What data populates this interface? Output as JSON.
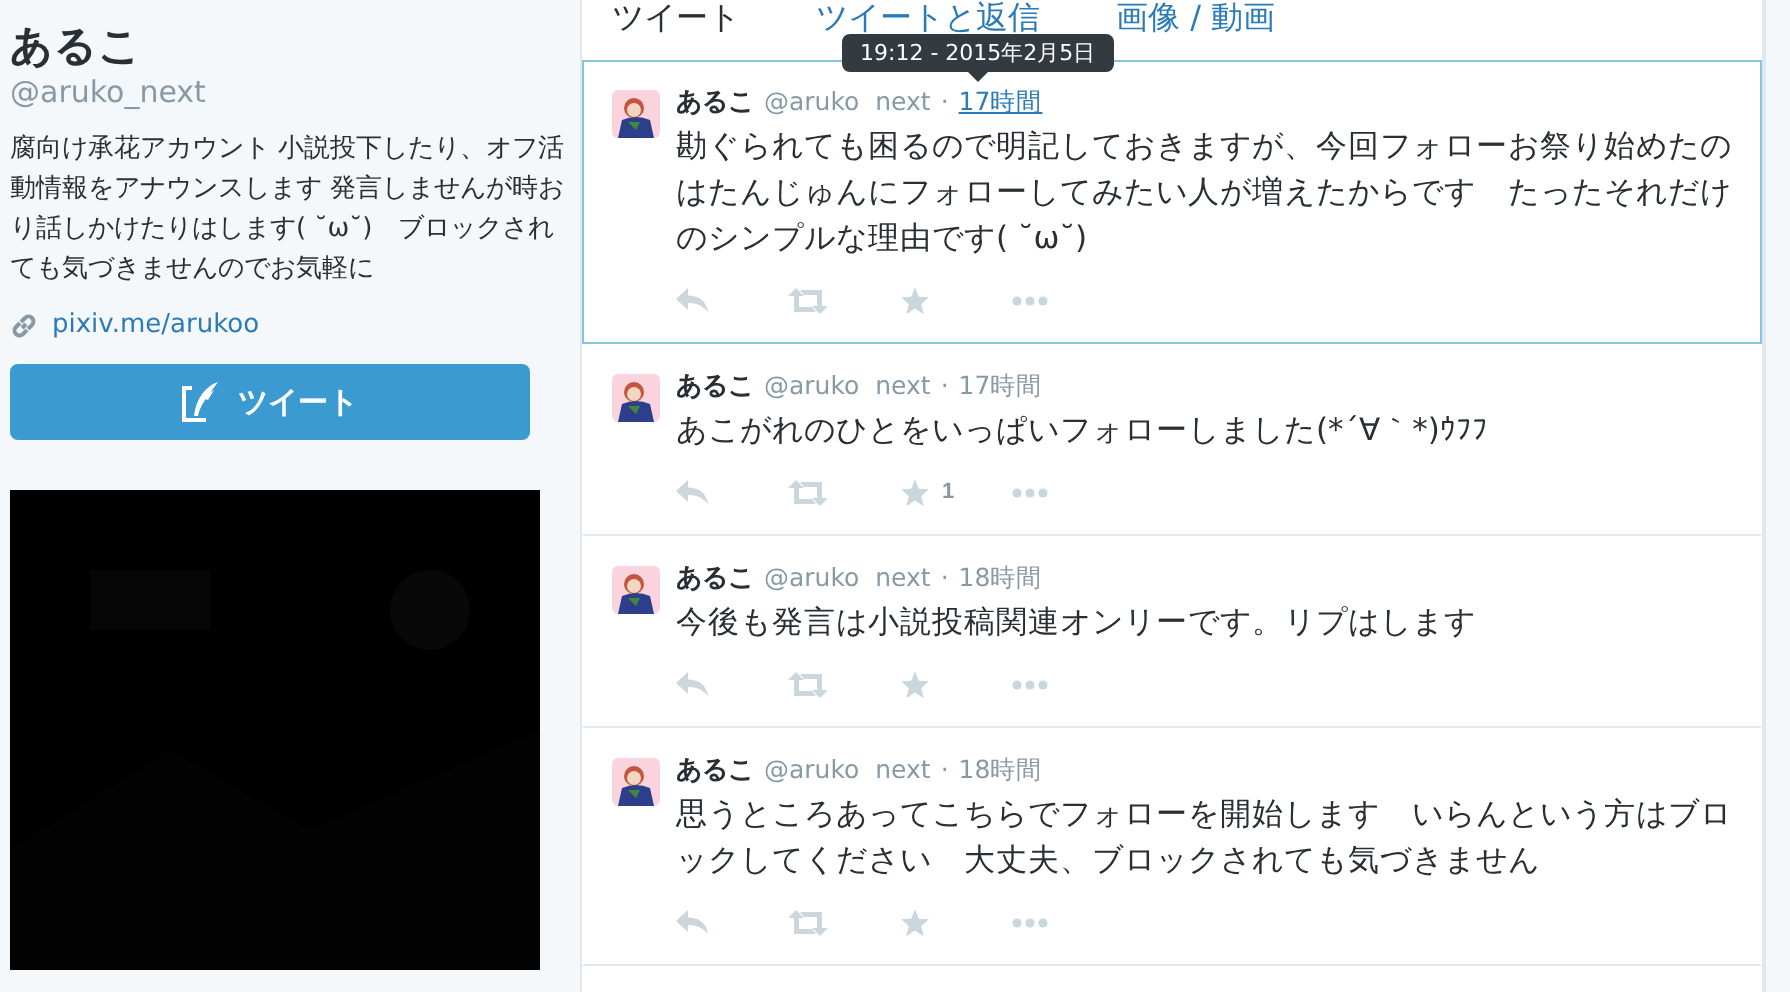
{
  "profile": {
    "name": "あるこ",
    "handle": "@aruko_next",
    "bio": "腐向け承花アカウント 小説投下したり、オフ活動情報をアナウンスします 発言しませんが時おり話しかけたりはします( ˘ω˘)　ブロックされても気づきませんのでお気軽に",
    "link": "pixiv.me/arukoo",
    "tweet_button": "ツイート"
  },
  "tabs": [
    {
      "label": "ツイート",
      "selected": true
    },
    {
      "label": "ツイートと返信",
      "selected": false
    },
    {
      "label": "画像 / 動画",
      "selected": false
    }
  ],
  "tooltip": "19:12 - 2015年2月5日",
  "separator": "·",
  "tweets": [
    {
      "name": "あるこ",
      "handle": "@aruko  next",
      "time": "17時間",
      "highlighted": true,
      "text": "勘ぐられても困るので明記しておきますが、今回フォローお祭り始めたのはたんじゅんにフォローしてみたい人が増えたからです　たったそれだけのシンプルな理由です( ˘ω˘)"
    },
    {
      "name": "あるこ",
      "handle": "@aruko  next",
      "time": "17時間",
      "highlighted": false,
      "text": "あこがれのひとをいっぱいフォローしました(*´∀｀*)ｳﾌﾌ",
      "favorites": "1"
    },
    {
      "name": "あるこ",
      "handle": "@aruko  next",
      "time": "18時間",
      "highlighted": false,
      "text": "今後も発言は小説投稿関連オンリーです。リプはします"
    },
    {
      "name": "あるこ",
      "handle": "@aruko  next",
      "time": "18時間",
      "highlighted": false,
      "text": "思うところあってこちらでフォローを開始します　いらんという方はブロックしてください　大丈夫、ブロックされても気づきません"
    }
  ]
}
